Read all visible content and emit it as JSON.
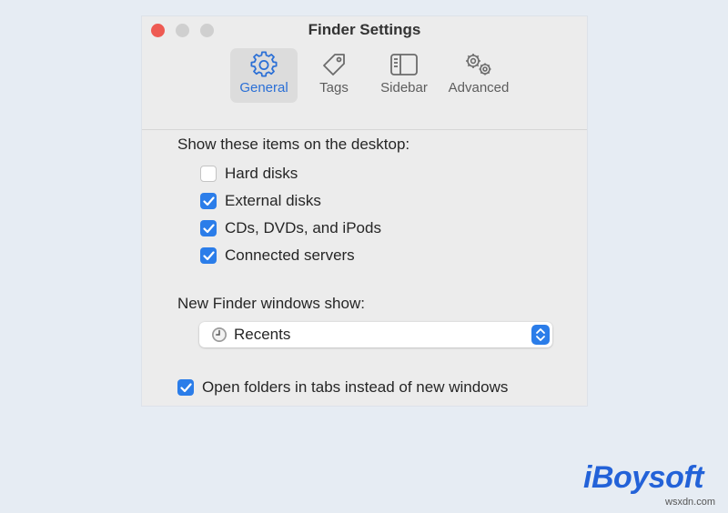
{
  "window": {
    "title": "Finder Settings"
  },
  "tabs": [
    {
      "label": "General",
      "icon": "gear-icon",
      "active": true
    },
    {
      "label": "Tags",
      "icon": "tag-icon",
      "active": false
    },
    {
      "label": "Sidebar",
      "icon": "sidebar-icon",
      "active": false
    },
    {
      "label": "Advanced",
      "icon": "gears-icon",
      "active": false
    }
  ],
  "desktop": {
    "heading": "Show these items on the desktop:",
    "items": [
      {
        "label": "Hard disks",
        "checked": false
      },
      {
        "label": "External disks",
        "checked": true
      },
      {
        "label": "CDs, DVDs, and iPods",
        "checked": true
      },
      {
        "label": "Connected servers",
        "checked": true
      }
    ]
  },
  "new_window": {
    "heading": "New Finder windows show:",
    "selected": "Recents",
    "icon": "clock-icon"
  },
  "open_folders": {
    "label": "Open folders in tabs instead of new windows",
    "checked": true
  },
  "branding": {
    "logo_text": "iBoysoft",
    "watermark": "wsxdn.com"
  },
  "colors": {
    "accent": "#2b7de9",
    "close": "#ee5a52",
    "brand": "#2362d8"
  }
}
